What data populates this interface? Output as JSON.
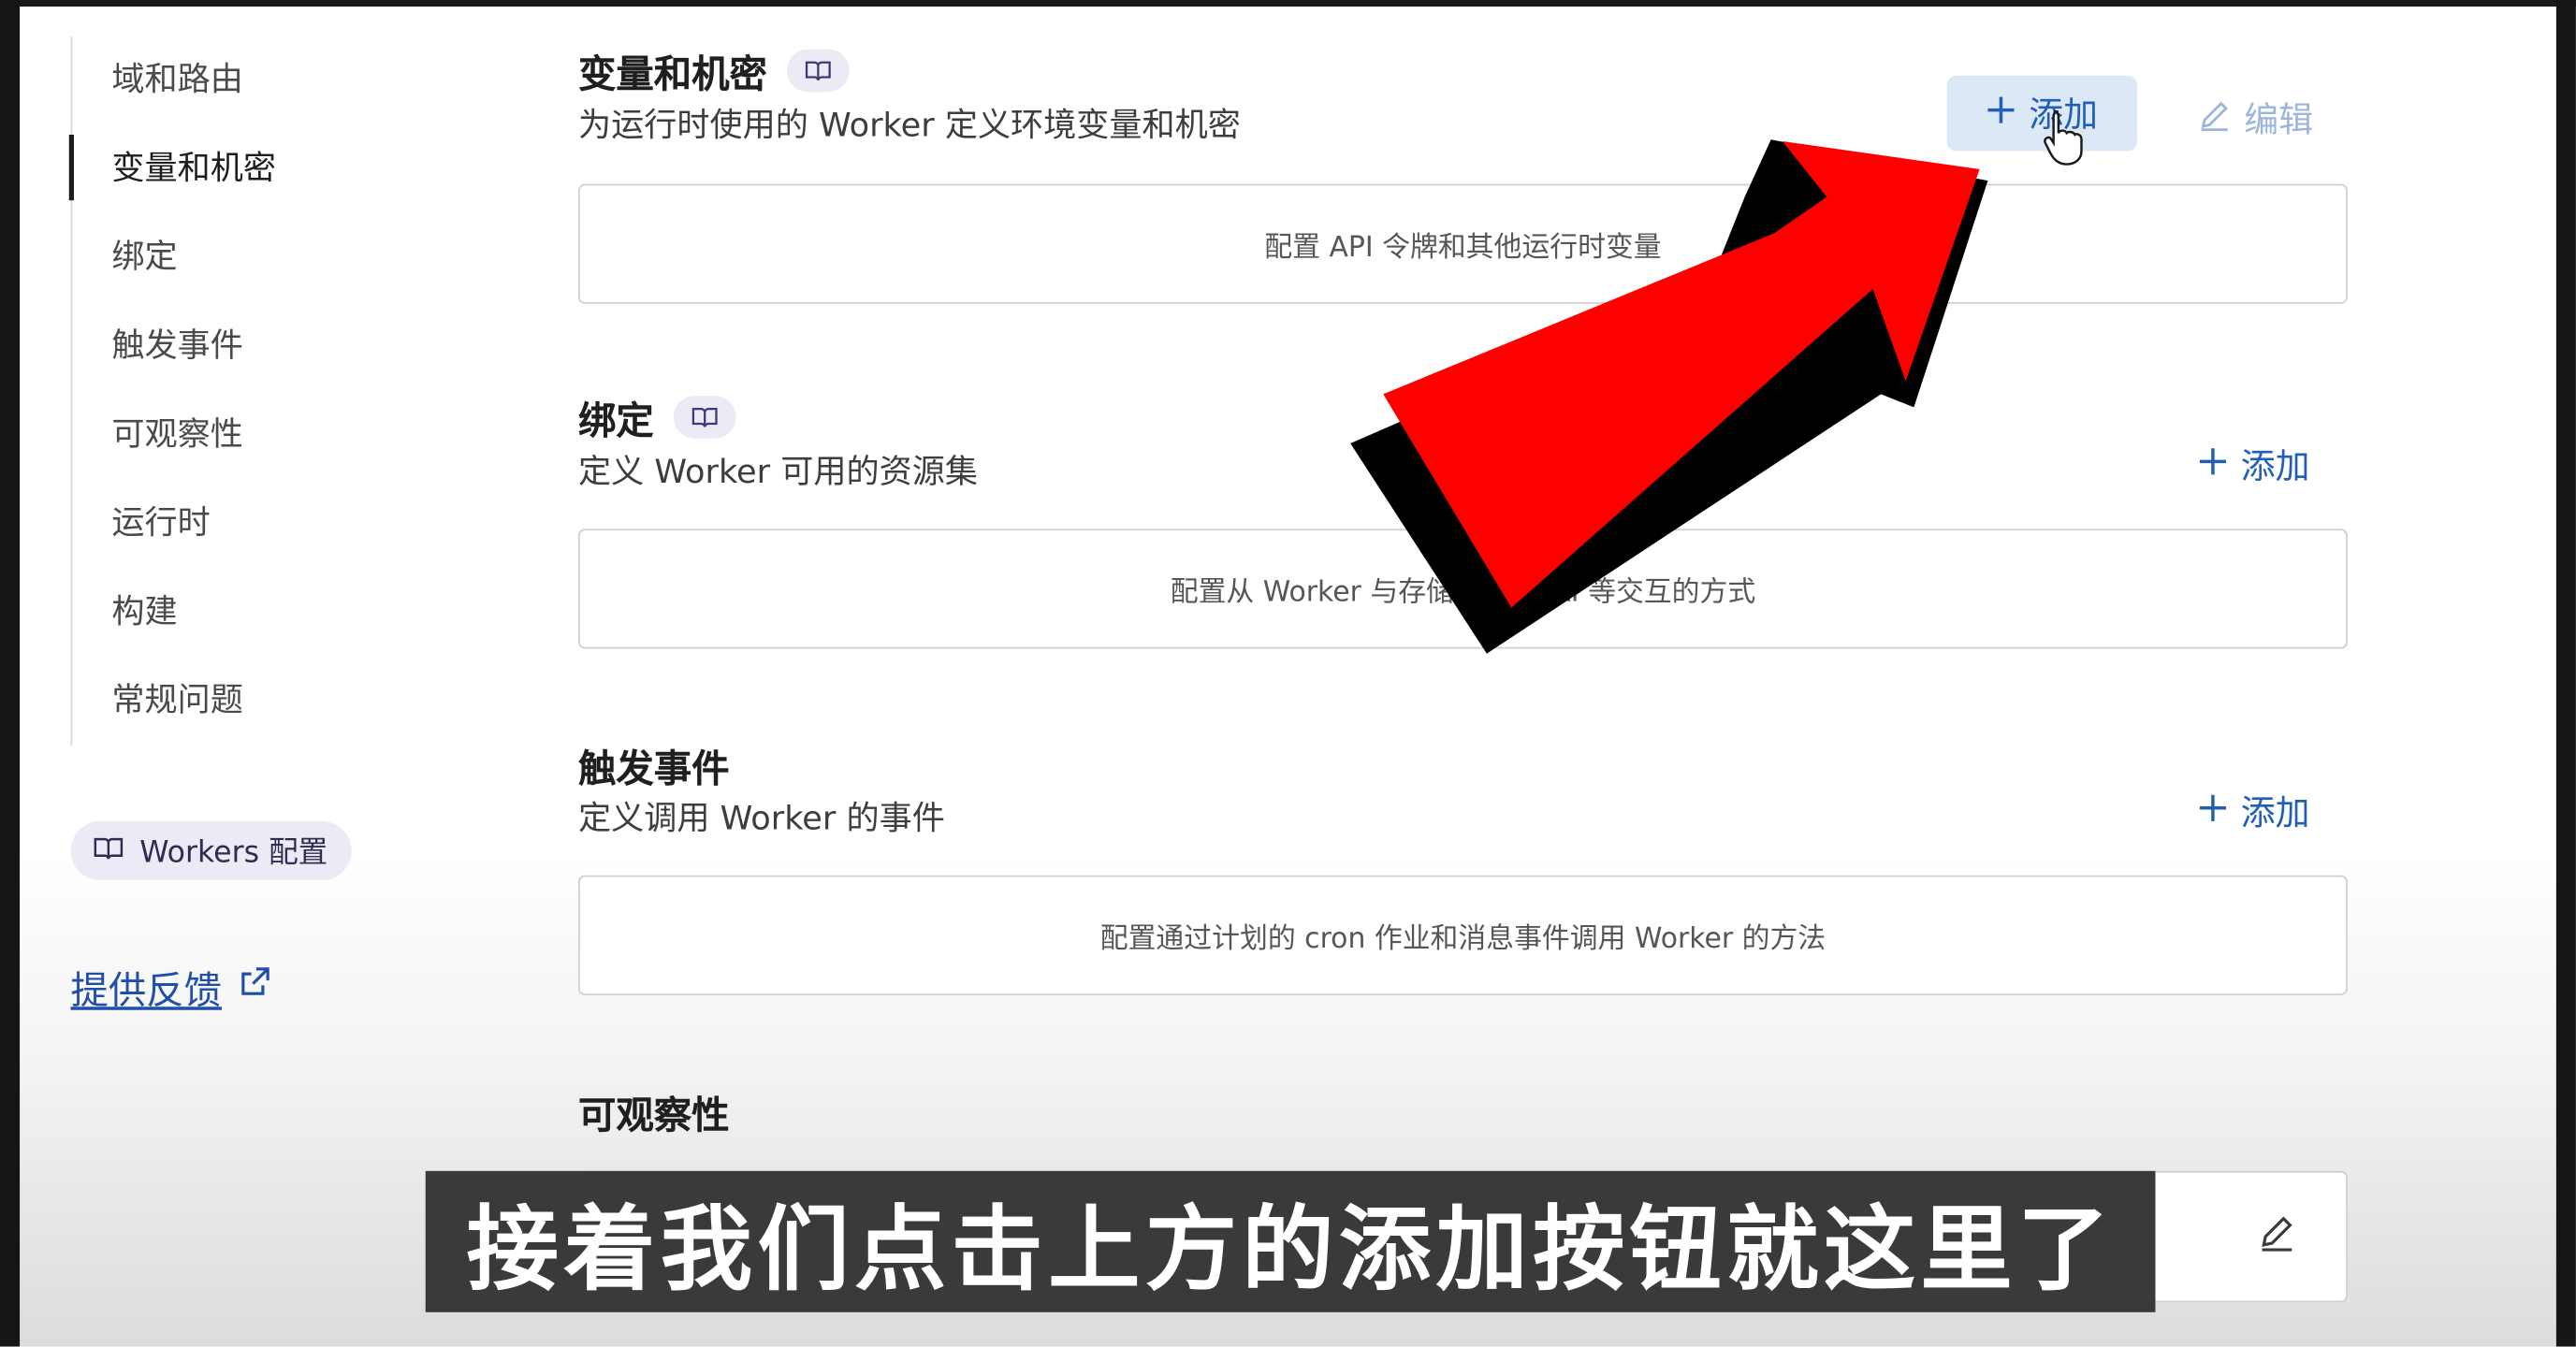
{
  "sidebar": {
    "items": [
      {
        "label": "域和路由"
      },
      {
        "label": "变量和机密"
      },
      {
        "label": "绑定"
      },
      {
        "label": "触发事件"
      },
      {
        "label": "可观察性"
      },
      {
        "label": "运行时"
      },
      {
        "label": "构建"
      },
      {
        "label": "常规问题"
      }
    ],
    "active_index": 1,
    "docs_link": "Workers 配置",
    "feedback_link": "提供反馈"
  },
  "sections": [
    {
      "title": "变量和机密",
      "description": "为运行时使用的 Worker 定义环境变量和机密",
      "empty_text": "配置 API 令牌和其他运行时变量",
      "add_label": "添加",
      "edit_label": "编辑"
    },
    {
      "title": "绑定",
      "description": "定义 Worker 可用的资源集",
      "empty_text": "配置从 Worker 与存储、　　　AI 等交互的方式",
      "add_label": "添加"
    },
    {
      "title": "触发事件",
      "description": "定义调用 Worker 的事件",
      "empty_text": "配置通过计划的 cron 作业和消息事件调用 Worker 的方法",
      "add_label": "添加"
    },
    {
      "title": "可观察性"
    }
  ],
  "subtitle": "接着我们点击上方的添加按钮就这里了",
  "colors": {
    "accent": "#1f5fb8",
    "arrow": "#ff0000",
    "subtitle_bg": "#3a3a3a"
  }
}
